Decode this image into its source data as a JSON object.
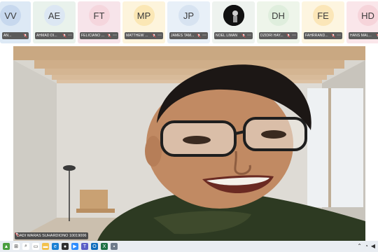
{
  "participants": [
    {
      "initials": "VV",
      "name": "AN...",
      "color": "#dde9f5",
      "avatar_color": "#c7d8ee",
      "partial": true
    },
    {
      "initials": "AE",
      "name": "AHMAD DI...",
      "color": "#e9f2ec",
      "avatar_color": "#dce7f3"
    },
    {
      "initials": "FT",
      "name": "FELICIANO ...",
      "color": "#f7e4ea",
      "avatar_color": "#f5d6dd"
    },
    {
      "initials": "MP",
      "name": "MATTHEW ...",
      "color": "#fdf4dc",
      "avatar_color": "#fbe7b5"
    },
    {
      "initials": "JP",
      "name": "JAMES TAM...",
      "color": "#e8f0f8",
      "avatar_color": "#d7e3f1"
    },
    {
      "initials": "",
      "name": "NOEL LIMAN",
      "color": "#eef3ef",
      "avatar_color": "#101010",
      "photo": true
    },
    {
      "initials": "DH",
      "name": "DZIDRI HAY...",
      "color": "#eef5ea",
      "avatar_color": "#dfeedd"
    },
    {
      "initials": "FE",
      "name": "FAHRRAND...",
      "color": "#fdf5e0",
      "avatar_color": "#fbe6b8"
    },
    {
      "initials": "HD",
      "name": "HANS MAL...",
      "color": "#fae6ea",
      "avatar_color": "#f6d4da"
    }
  ],
  "main_video": {
    "speaker_name": "DADI WARAS SUHARDIONO 10019006"
  },
  "icons": {
    "mic_off": "mic-off-icon",
    "more": "more-options-icon"
  },
  "taskbar": {
    "apps": [
      {
        "name": "widgets-icon",
        "color": "#4a9e3f",
        "glyph": "▲"
      },
      {
        "name": "windows-icon",
        "color": "#ffffff",
        "glyph": "⊞"
      },
      {
        "name": "search-icon",
        "color": "#ffffff",
        "glyph": "⌕"
      },
      {
        "name": "task-view-icon",
        "color": "#ffffff",
        "glyph": "▭"
      },
      {
        "name": "file-explorer-icon",
        "color": "#f2c14e",
        "glyph": "▬"
      },
      {
        "name": "edge-icon",
        "color": "#1a7fd4",
        "glyph": "e"
      },
      {
        "name": "chrome-icon",
        "color": "#2f2f2f",
        "glyph": "●"
      },
      {
        "name": "zoom-icon",
        "color": "#2d8cff",
        "glyph": "▶"
      },
      {
        "name": "teams-icon",
        "color": "#5b5fc7",
        "glyph": "T"
      },
      {
        "name": "outlook-icon",
        "color": "#0f6cbd",
        "glyph": "O"
      },
      {
        "name": "excel-icon",
        "color": "#1d7044",
        "glyph": "X"
      },
      {
        "name": "app-icon",
        "color": "#6e7b8b",
        "glyph": "▪"
      }
    ]
  }
}
